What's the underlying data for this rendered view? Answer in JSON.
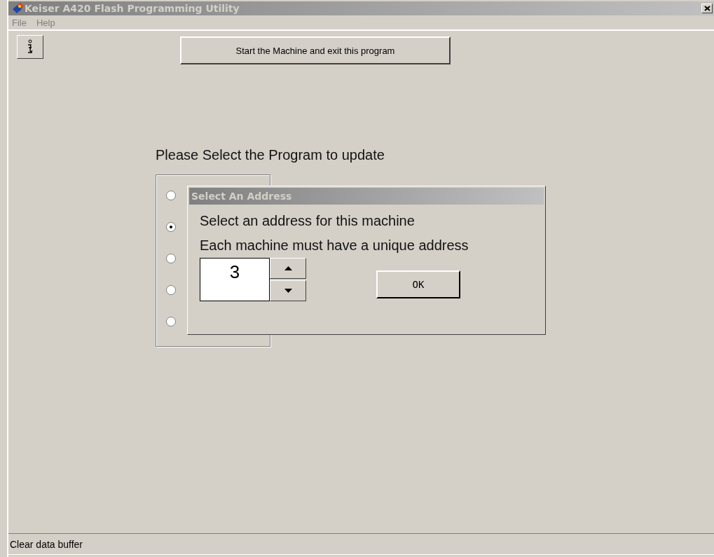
{
  "window": {
    "title": "Keiser A420 Flash Programming Utility"
  },
  "menu": [
    "File",
    "Help"
  ],
  "toolbar": {
    "start_button": "Start the Machine and exit this program"
  },
  "prompt": "Please Select the Program to update",
  "programs": [
    {
      "selected": false
    },
    {
      "selected": true
    },
    {
      "selected": false
    },
    {
      "selected": false
    },
    {
      "selected": false
    }
  ],
  "dialog": {
    "title": "Select An Address",
    "line_1": "Select an address for this machine",
    "line_2": "Each machine must have a unique address",
    "address": "3",
    "ok_button": "OK"
  },
  "status_bar": "Clear data buffer"
}
